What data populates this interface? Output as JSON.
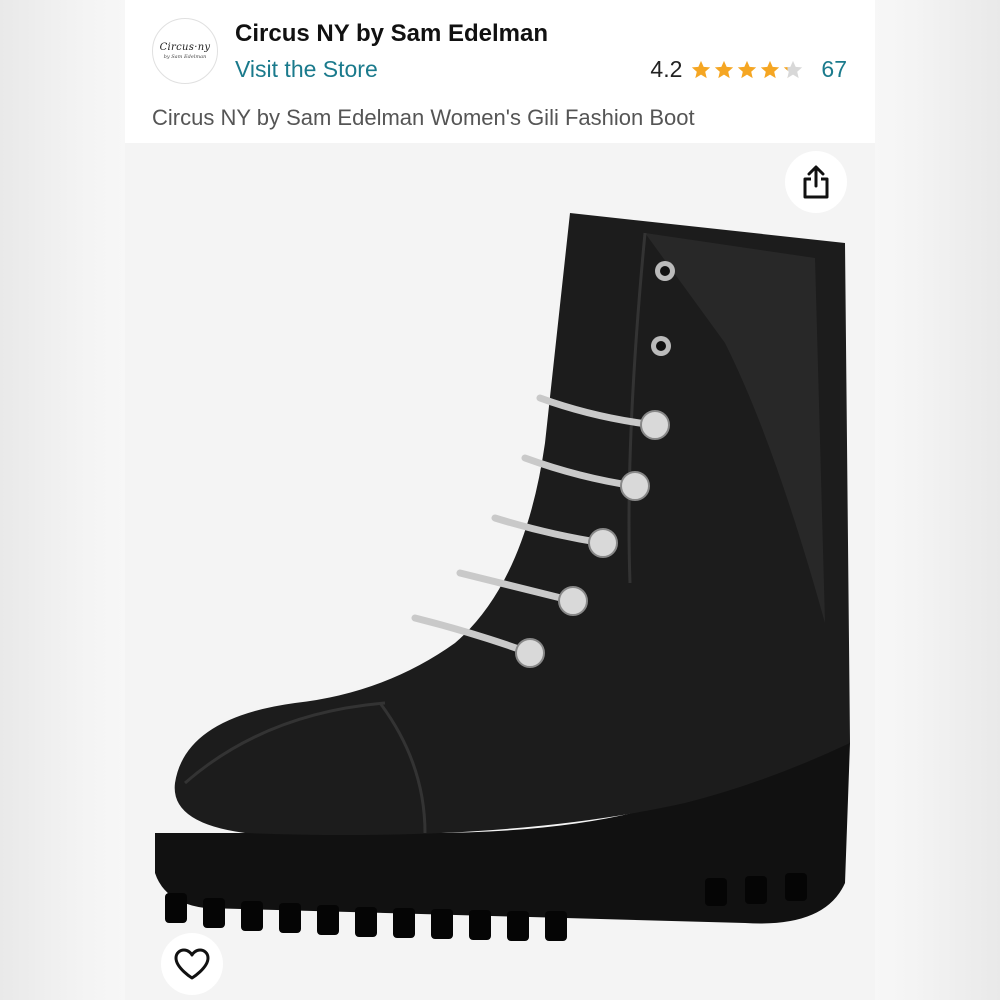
{
  "header": {
    "brand_name": "Circus NY by Sam Edelman",
    "visit_store_label": "Visit the Store",
    "logo_text": "Circus·ny",
    "logo_subtext": "by Sam Edelman",
    "rating_value": "4.2",
    "rating_stars": 4.2,
    "rating_count": "67",
    "product_title": "Circus NY by Sam Edelman Women's Gili Fashion Boot"
  },
  "icons": {
    "share": "share-icon",
    "favorite": "heart-icon",
    "star": "star-icon"
  },
  "colors": {
    "link": "#1a7a8c",
    "star_filled": "#f5a623",
    "star_empty": "#d8d8d8",
    "image_bg": "#f4f4f4"
  }
}
